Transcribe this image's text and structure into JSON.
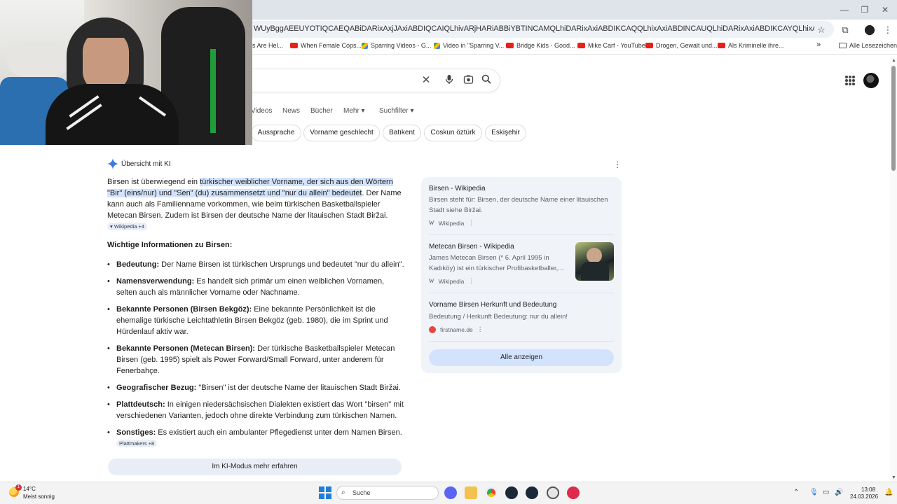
{
  "browser": {
    "url": "WUyBggAEEUYOTIQCAEQABiDARixAxjJAxiABDIQCAIQLhivARjHARiABBiYBTINCAMQLhiDARixAxiABDIKCAQQLhixAxiABDINCAUQLhiDARixAxiABDIKCAYQLhixAxiABDIKCAcQABixAxiABDIQCAgQL...",
    "bookmarks": [
      {
        "label": "s Are Hel..."
      },
      {
        "label": "When Female Cops..."
      },
      {
        "label": "Sparring Videos - G..."
      },
      {
        "label": "Video in \"Sparring V..."
      },
      {
        "label": "Bridge Kids - Good..."
      },
      {
        "label": "Mike Carf - YouTube"
      },
      {
        "label": "Drogen, Gewalt und..."
      },
      {
        "label": "Als Kriminelle ihre..."
      },
      {
        "label": "»"
      },
      {
        "label": "Alle Lesezeichen"
      }
    ]
  },
  "google": {
    "tabs": [
      "Videos",
      "News",
      "Bücher",
      "Mehr ▾",
      "Suchfilter ▾"
    ],
    "chips": [
      "Aussprache",
      "Vorname geschlecht",
      "Batıkent",
      "Coskun öztürk",
      "Eskişehir"
    ]
  },
  "ai": {
    "title": "Übersicht mit KI",
    "intro_1": "Birsen ist überwiegend ein ",
    "intro_hl": "türkischer weiblicher Vorname, der sich aus den Wörtern \"Bir\" (eins/nur) und \"Sen\" (du) zusammensetzt und \"nur du allein\" bedeutet",
    "intro_2": ". Der Name kann auch als Familienname vorkommen, wie beim türkischen Basketballspieler Metecan Birsen. Zudem ist Birsen der deutsche Name der litauischen Stadt Biržai.",
    "intro_cite": "Wikipedia +4",
    "subhead": "Wichtige Informationen zu Birsen:",
    "bullets": [
      {
        "label": "Bedeutung:",
        "text": " Der Name Birsen ist türkischen Ursprungs und bedeutet \"nur du allein\"."
      },
      {
        "label": "Namensverwendung:",
        "text": " Es handelt sich primär um einen weiblichen Vornamen, selten auch als männlicher Vorname oder Nachname."
      },
      {
        "label": "Bekannte Personen (Birsen Bekgöz):",
        "text": " Eine bekannte Persönlichkeit ist die ehemalige türkische Leichtathletin Birsen Bekgöz (geb. 1980), die im Sprint und Hürdenlauf aktiv war."
      },
      {
        "label": "Bekannte Personen (Metecan Birsen):",
        "text": " Der türkische Basketballspieler Metecan Birsen (geb. 1995) spielt als Power Forward/Small Forward, unter anderem für Fenerbahçe."
      },
      {
        "label": "Geografischer Bezug:",
        "text": " \"Birsen\" ist der deutsche Name der litauischen Stadt Biržai."
      },
      {
        "label": "Plattdeutsch:",
        "text": " In einigen niedersächsischen Dialekten existiert das Wort \"birsen\" mit verschiedenen Varianten, jedoch ohne direkte Verbindung zum türkischen Namen."
      },
      {
        "label": "Sonstiges:",
        "text": " Es existiert auch ein ambulanter Pflegedienst unter dem Namen Birsen.",
        "cite": "Plattmakers +8"
      }
    ],
    "more_button": "Im KI-Modus mehr erfahren"
  },
  "sources": [
    {
      "title": "Birsen - Wikipedia",
      "desc": "Birsen steht für: Birsen, der deutsche Name einer litauischen Stadt siehe Biržai.",
      "site": "Wikipedia"
    },
    {
      "title": "Metecan Birsen - Wikipedia",
      "desc": "James Metecan Birsen (* 6. April 1995 in Kadıköy) ist ein türkischer Profibasketballer,...",
      "site": "Wikipedia"
    },
    {
      "title": "Vorname Birsen Herkunft und Bedeutung",
      "desc": "Bedeutung / Herkunft Bedeutung: nur du allein!",
      "site": "firstname.de"
    }
  ],
  "show_all": "Alle anzeigen",
  "taskbar": {
    "temp": "14°C",
    "weather": "Meist sonnig",
    "weather_badge": "1",
    "search": "Suche",
    "time": "13:08",
    "date": "24.03.2026"
  },
  "colors": {
    "accent": "#1a73e8",
    "highlight": "#d3e3fd",
    "panel": "#f0f4f9"
  }
}
